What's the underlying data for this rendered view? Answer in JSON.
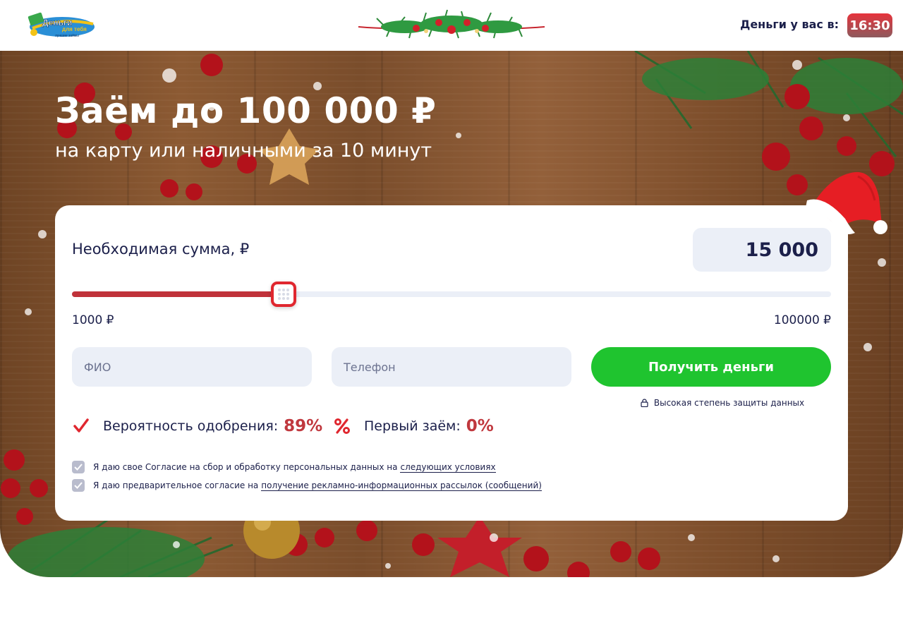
{
  "header": {
    "logo": {
      "title": "Деньги",
      "subtitle": "для тебя",
      "tagline": "лучшие займы",
      "icon": "money-logo-icon"
    },
    "garland_icon": "christmas-garland-icon",
    "money_label": "Деньги у вас в:",
    "time": "16:30"
  },
  "hero": {
    "title": "Заём до 100 000 ₽",
    "subtitle": "на карту или наличными за 10 минут"
  },
  "form": {
    "amount_label": "Необходимая сумма, ₽",
    "amount_value": "15 000",
    "amount_number": 15000,
    "slider_min_value": 1000,
    "slider_max_value": 100000,
    "slider_min_label": "1000 ₽",
    "slider_max_label": "100000 ₽",
    "name_placeholder": "ФИО",
    "phone_placeholder": "Телефон",
    "submit_label": "Получить деньги",
    "secure_text": "Высокая степень защиты данных"
  },
  "stats": {
    "approval_label": "Вероятность одобрения:",
    "approval_value": "89%",
    "first_loan_label": "Первый заём:",
    "first_loan_value": "0%"
  },
  "consents": [
    {
      "text": "Я даю свое Согласие на сбор и обработку персональных данных на",
      "link": "следующих условиях",
      "checked": true
    },
    {
      "text": "Я даю предварительное согласие на",
      "link": "получение рекламно-информационных рассылок (сообщений)",
      "checked": true
    }
  ],
  "colors": {
    "accent_red": "#e0272f",
    "slider_fill": "#c0323a",
    "button_green": "#1fc42f",
    "text_dark": "#1b1f4a",
    "field_bg": "#ebeff7"
  }
}
